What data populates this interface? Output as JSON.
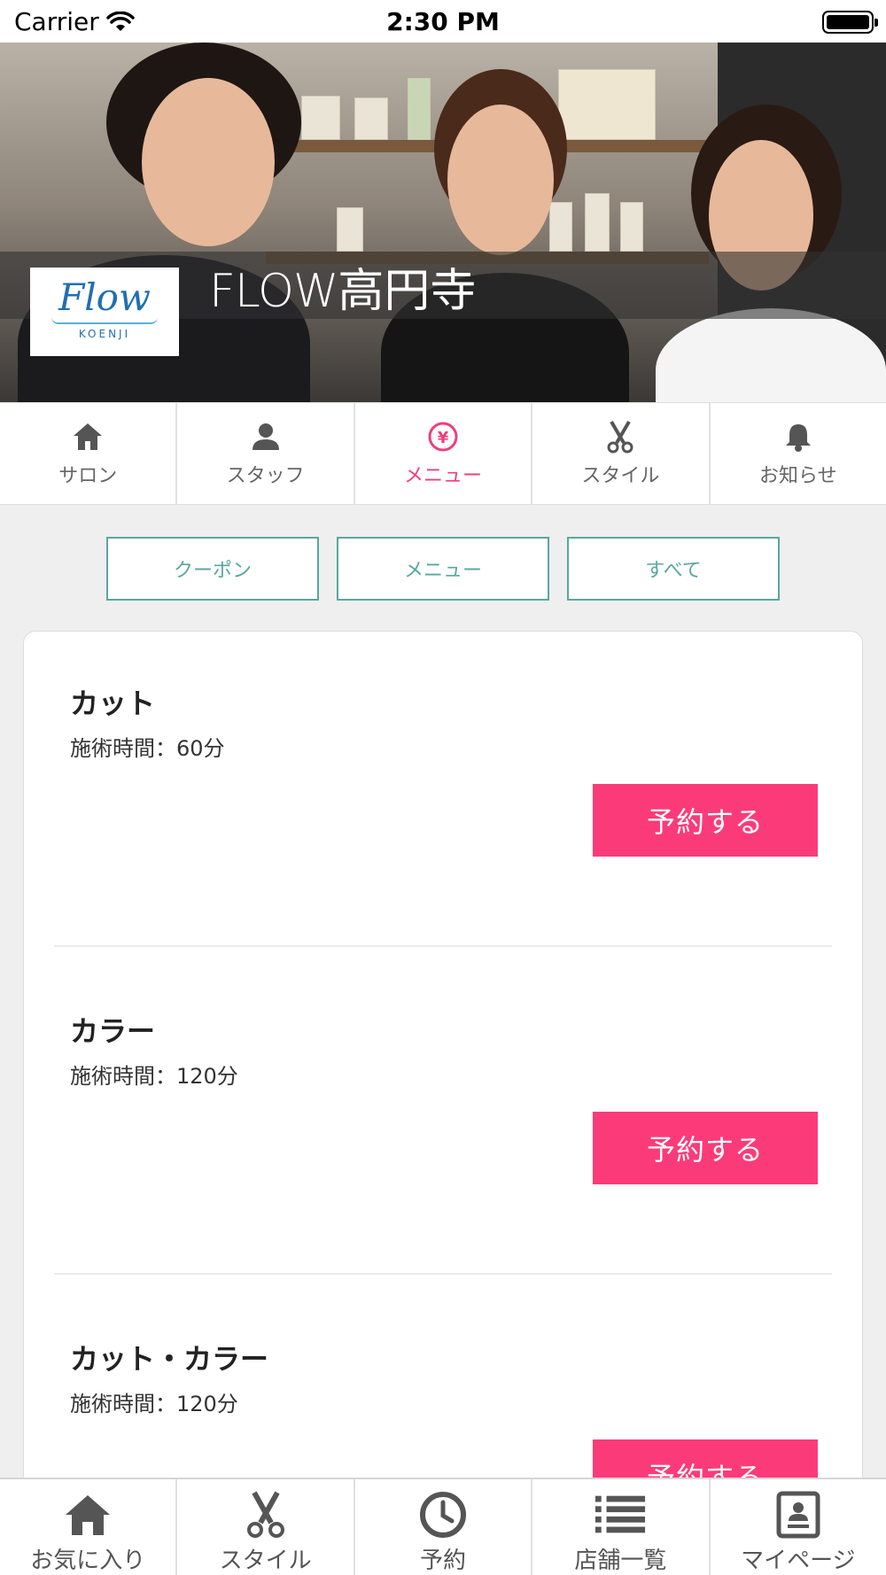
{
  "status_bar": {
    "carrier": "Carrier",
    "time": "2:30 PM"
  },
  "hero": {
    "title_latin": "FLOW",
    "title_jp": "高円寺",
    "logo": {
      "text": "Flow",
      "sub": "KOENJI"
    }
  },
  "tabs": [
    {
      "label": "サロン",
      "icon": "home-icon",
      "active": false
    },
    {
      "label": "スタッフ",
      "icon": "person-icon",
      "active": false
    },
    {
      "label": "メニュー",
      "icon": "yen-icon",
      "active": true
    },
    {
      "label": "スタイル",
      "icon": "scissors-icon",
      "active": false
    },
    {
      "label": "お知らせ",
      "icon": "bell-icon",
      "active": false
    }
  ],
  "filters": [
    "クーポン",
    "メニュー",
    "すべて"
  ],
  "menu_items": [
    {
      "name": "カット",
      "duration": "施術時間：60分",
      "button": "予約する"
    },
    {
      "name": "カラー",
      "duration": "施術時間：120分",
      "button": "予約する"
    },
    {
      "name": "カット・カラー",
      "duration": "施術時間：120分",
      "button": "予約する"
    }
  ],
  "bottom_nav": [
    {
      "label": "お気に入り",
      "icon": "home-icon"
    },
    {
      "label": "スタイル",
      "icon": "scissors-icon"
    },
    {
      "label": "予約",
      "icon": "clock-icon"
    },
    {
      "label": "店舗一覧",
      "icon": "list-icon"
    },
    {
      "label": "マイページ",
      "icon": "profile-icon"
    }
  ],
  "colors": {
    "accent_pink": "#fb3b79",
    "tab_active": "#ef3e7f",
    "teal": "#5aa6a1"
  }
}
